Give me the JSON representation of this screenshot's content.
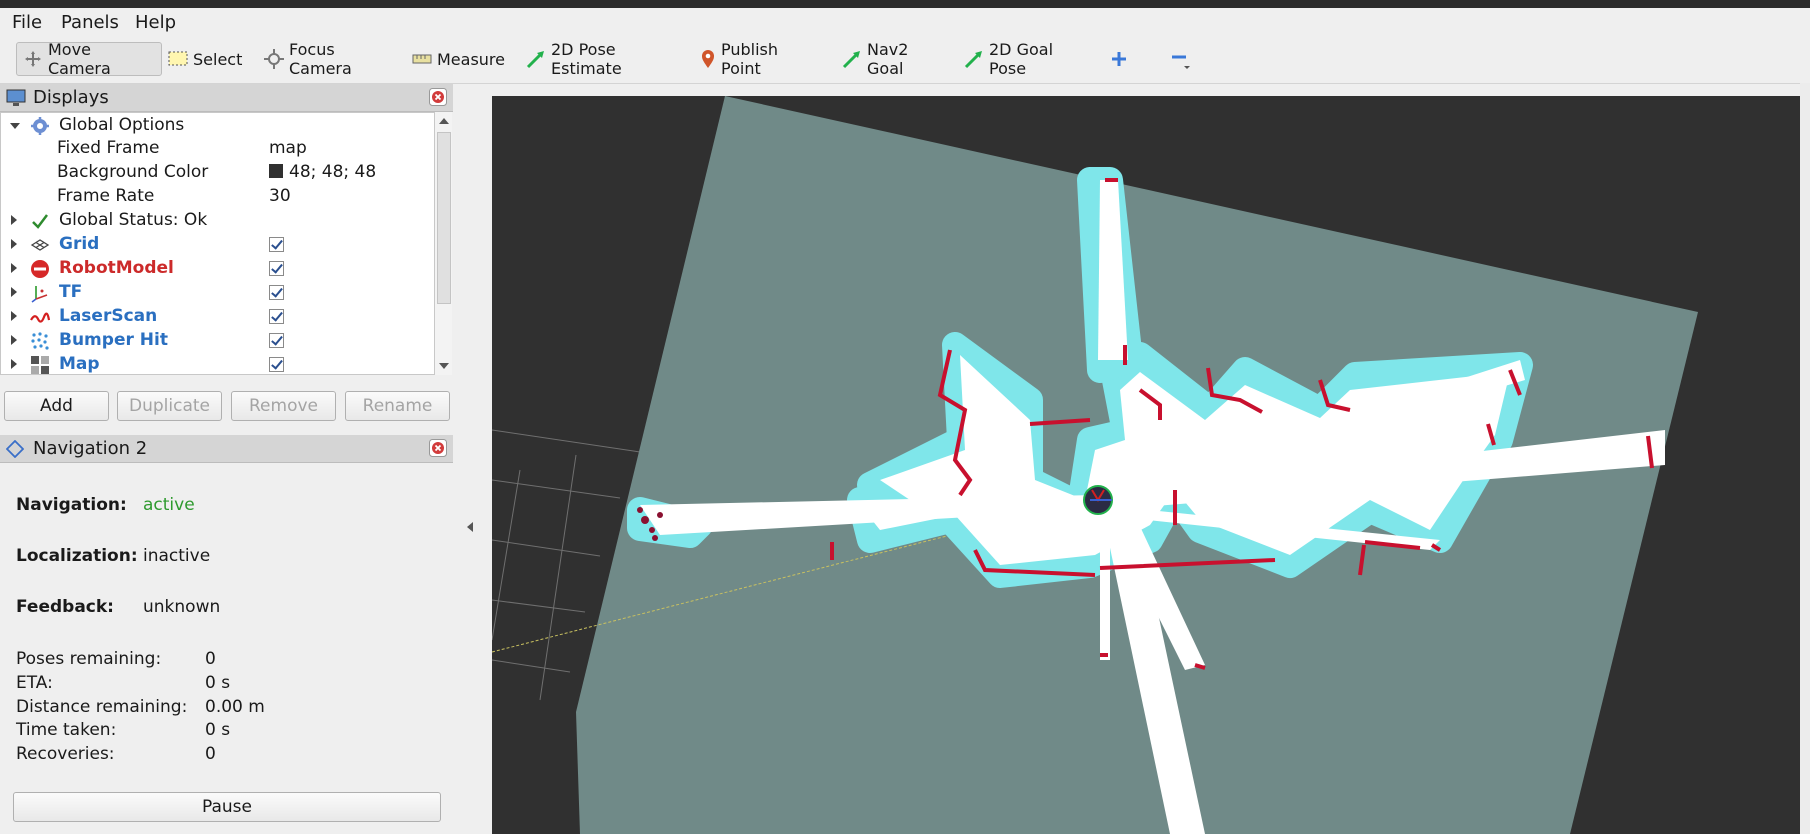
{
  "menu": {
    "items": [
      {
        "label": "File"
      },
      {
        "label": "Panels"
      },
      {
        "label": "Help"
      }
    ]
  },
  "toolbar": {
    "tools": [
      {
        "label": "Move Camera",
        "icon": "move-camera-icon"
      },
      {
        "label": "Select",
        "icon": "select-icon"
      },
      {
        "label": "Focus Camera",
        "icon": "focus-camera-icon"
      },
      {
        "label": "Measure",
        "icon": "measure-icon"
      },
      {
        "label": "2D Pose Estimate",
        "icon": "pose-estimate-icon"
      },
      {
        "label": "Publish Point",
        "icon": "publish-point-icon"
      },
      {
        "label": "Nav2 Goal",
        "icon": "nav2-goal-icon"
      },
      {
        "label": "2D Goal Pose",
        "icon": "goal-pose-icon"
      }
    ]
  },
  "displays": {
    "title": "Displays",
    "global_options": {
      "label": "Global Options",
      "fixed_frame": {
        "label": "Fixed Frame",
        "value": "map"
      },
      "background_color": {
        "label": "Background Color",
        "value": "48; 48; 48",
        "swatch": "#303030"
      },
      "frame_rate": {
        "label": "Frame Rate",
        "value": "30"
      }
    },
    "global_status": "Global Status: Ok",
    "items": [
      {
        "label": "Grid",
        "checked": true,
        "color": "#2a6fc0"
      },
      {
        "label": "RobotModel",
        "checked": true,
        "color": "#cc2a2a"
      },
      {
        "label": "TF",
        "checked": true,
        "color": "#2a6fc0"
      },
      {
        "label": "LaserScan",
        "checked": true,
        "color": "#2a6fc0"
      },
      {
        "label": "Bumper Hit",
        "checked": true,
        "color": "#2a6fc0"
      },
      {
        "label": "Map",
        "checked": true,
        "color": "#2a6fc0"
      }
    ],
    "buttons": {
      "add": "Add",
      "duplicate": "Duplicate",
      "remove": "Remove",
      "rename": "Rename"
    }
  },
  "navigation": {
    "title": "Navigation 2",
    "navigation_label": "Navigation:",
    "navigation_value": "active",
    "localization_label": "Localization:",
    "localization_value": "inactive",
    "feedback_label": "Feedback:",
    "feedback_value": "unknown",
    "stats": [
      {
        "label": "Poses remaining:",
        "value": "0"
      },
      {
        "label": "ETA:",
        "value": "0 s"
      },
      {
        "label": "Distance remaining:",
        "value": "0.00 m"
      },
      {
        "label": "Time taken:",
        "value": "0 s"
      },
      {
        "label": "Recoveries:",
        "value": "0"
      }
    ],
    "pause_label": "Pause"
  },
  "colors": {
    "viewport_bg": "#303030",
    "map_free": "#ffffff",
    "map_unknown": "#708a88",
    "inflation": "#7fe6ea",
    "obstacle": "#c8102e",
    "active_status": "#2e9a2e"
  }
}
